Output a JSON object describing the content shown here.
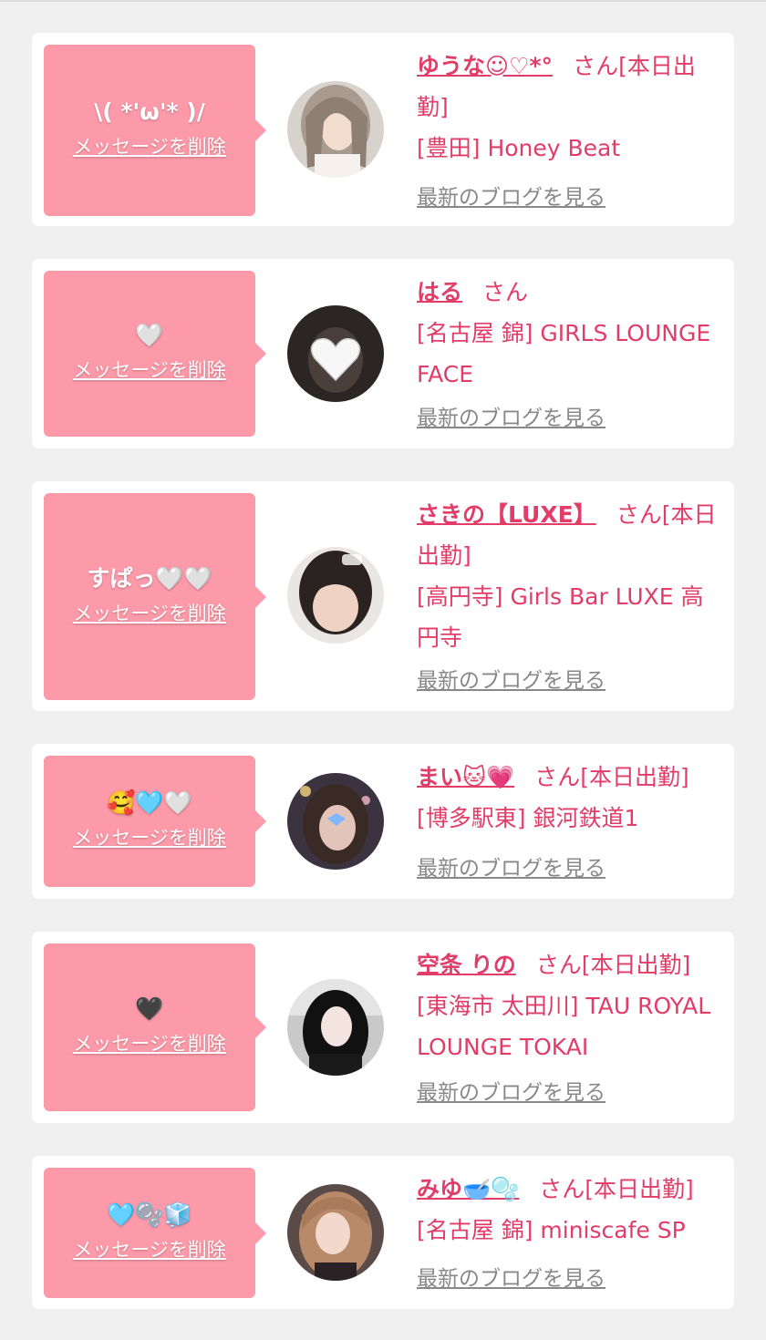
{
  "cards": [
    {
      "message": "\\( *'ω'* )/",
      "delete_label": "メッセージを削除",
      "name": "ゆうな☺︎♡*°",
      "suffix": "さん[本日出勤]",
      "shop": "[豊田] Honey Beat",
      "blog_label": "最新のブログを見る"
    },
    {
      "message": "🤍",
      "delete_label": "メッセージを削除",
      "name": "はる",
      "suffix": "さん",
      "shop": "[名古屋 錦] GIRLS LOUNGE FACE",
      "blog_label": "最新のブログを見る"
    },
    {
      "message": "すぱっ🤍🤍",
      "delete_label": "メッセージを削除",
      "name": "さきの【LUXE】",
      "suffix": "さん[本日出勤]",
      "shop": "[高円寺] Girls Bar LUXE 高円寺",
      "blog_label": "最新のブログを見る"
    },
    {
      "message": "🥰🩵🤍",
      "delete_label": "メッセージを削除",
      "name": "まい🐱💗",
      "suffix": "さん[本日出勤]",
      "shop": "[博多駅東] 銀河鉄道1",
      "blog_label": "最新のブログを見る"
    },
    {
      "message": "🖤",
      "delete_label": "メッセージを削除",
      "name": "空条 りの",
      "suffix": "さん[本日出勤]",
      "shop": "[東海市 太田川] TAU ROYAL LOUNGE TOKAI",
      "blog_label": "最新のブログを見る"
    },
    {
      "message": "🩵🫧🧊",
      "delete_label": "メッセージを削除",
      "name": "みゆ🥣🫧",
      "suffix": "さん[本日出勤]",
      "shop": "[名古屋 錦] miniscafe SP",
      "blog_label": "最新のブログを見る"
    }
  ],
  "colors": {
    "background": "#f0f0f0",
    "card": "#ffffff",
    "bubble": "#fd9aaa",
    "accent": "#e23c69",
    "link_gray": "#888888"
  }
}
